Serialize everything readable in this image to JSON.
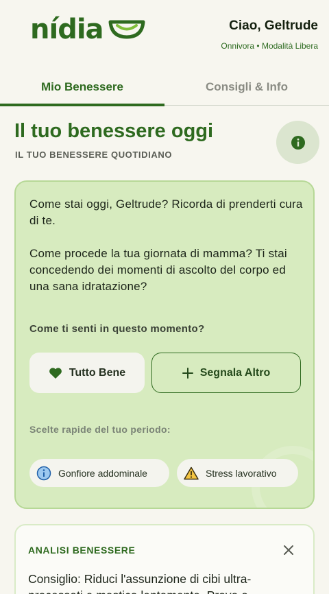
{
  "header": {
    "logo_text": "nídia",
    "greeting": "Ciao, Geltrude",
    "profile": "Onnivora • Modalità Libera"
  },
  "tabs": [
    {
      "label": "Mio Benessere",
      "active": true
    },
    {
      "label": "Consigli & Info",
      "active": false
    }
  ],
  "page": {
    "title": "Il tuo benessere oggi",
    "subtitle": "IL TUO BENESSERE QUOTIDIANO",
    "info_icon": "info-icon"
  },
  "card": {
    "greeting": "Come stai oggi, Geltrude? Ricorda di prenderti cura di te.",
    "message": "Come procede la tua giornata di mamma? Ti stai concedendo dei momenti di ascolto del corpo ed una sana idratazione?",
    "question": "Come ti senti in questo momento?",
    "btn_good": "Tutto Bene",
    "btn_other": "Segnala Altro",
    "quick_label": "Scelte rapide del tuo periodo:",
    "chips": [
      {
        "label": "Gonfiore addominale",
        "icon": "info-icon"
      },
      {
        "label": "Stress lavorativo",
        "icon": "warning-icon"
      }
    ]
  },
  "analysis": {
    "title": "ANALISI BENESSERE",
    "text": "Consiglio: Riduci l'assunzione di cibi ultra-processati e mastica lentamente. Prova a"
  },
  "colors": {
    "brand": "#2e6a1f",
    "card_bg": "#d7ebbf",
    "background": "#f7f6ef"
  }
}
